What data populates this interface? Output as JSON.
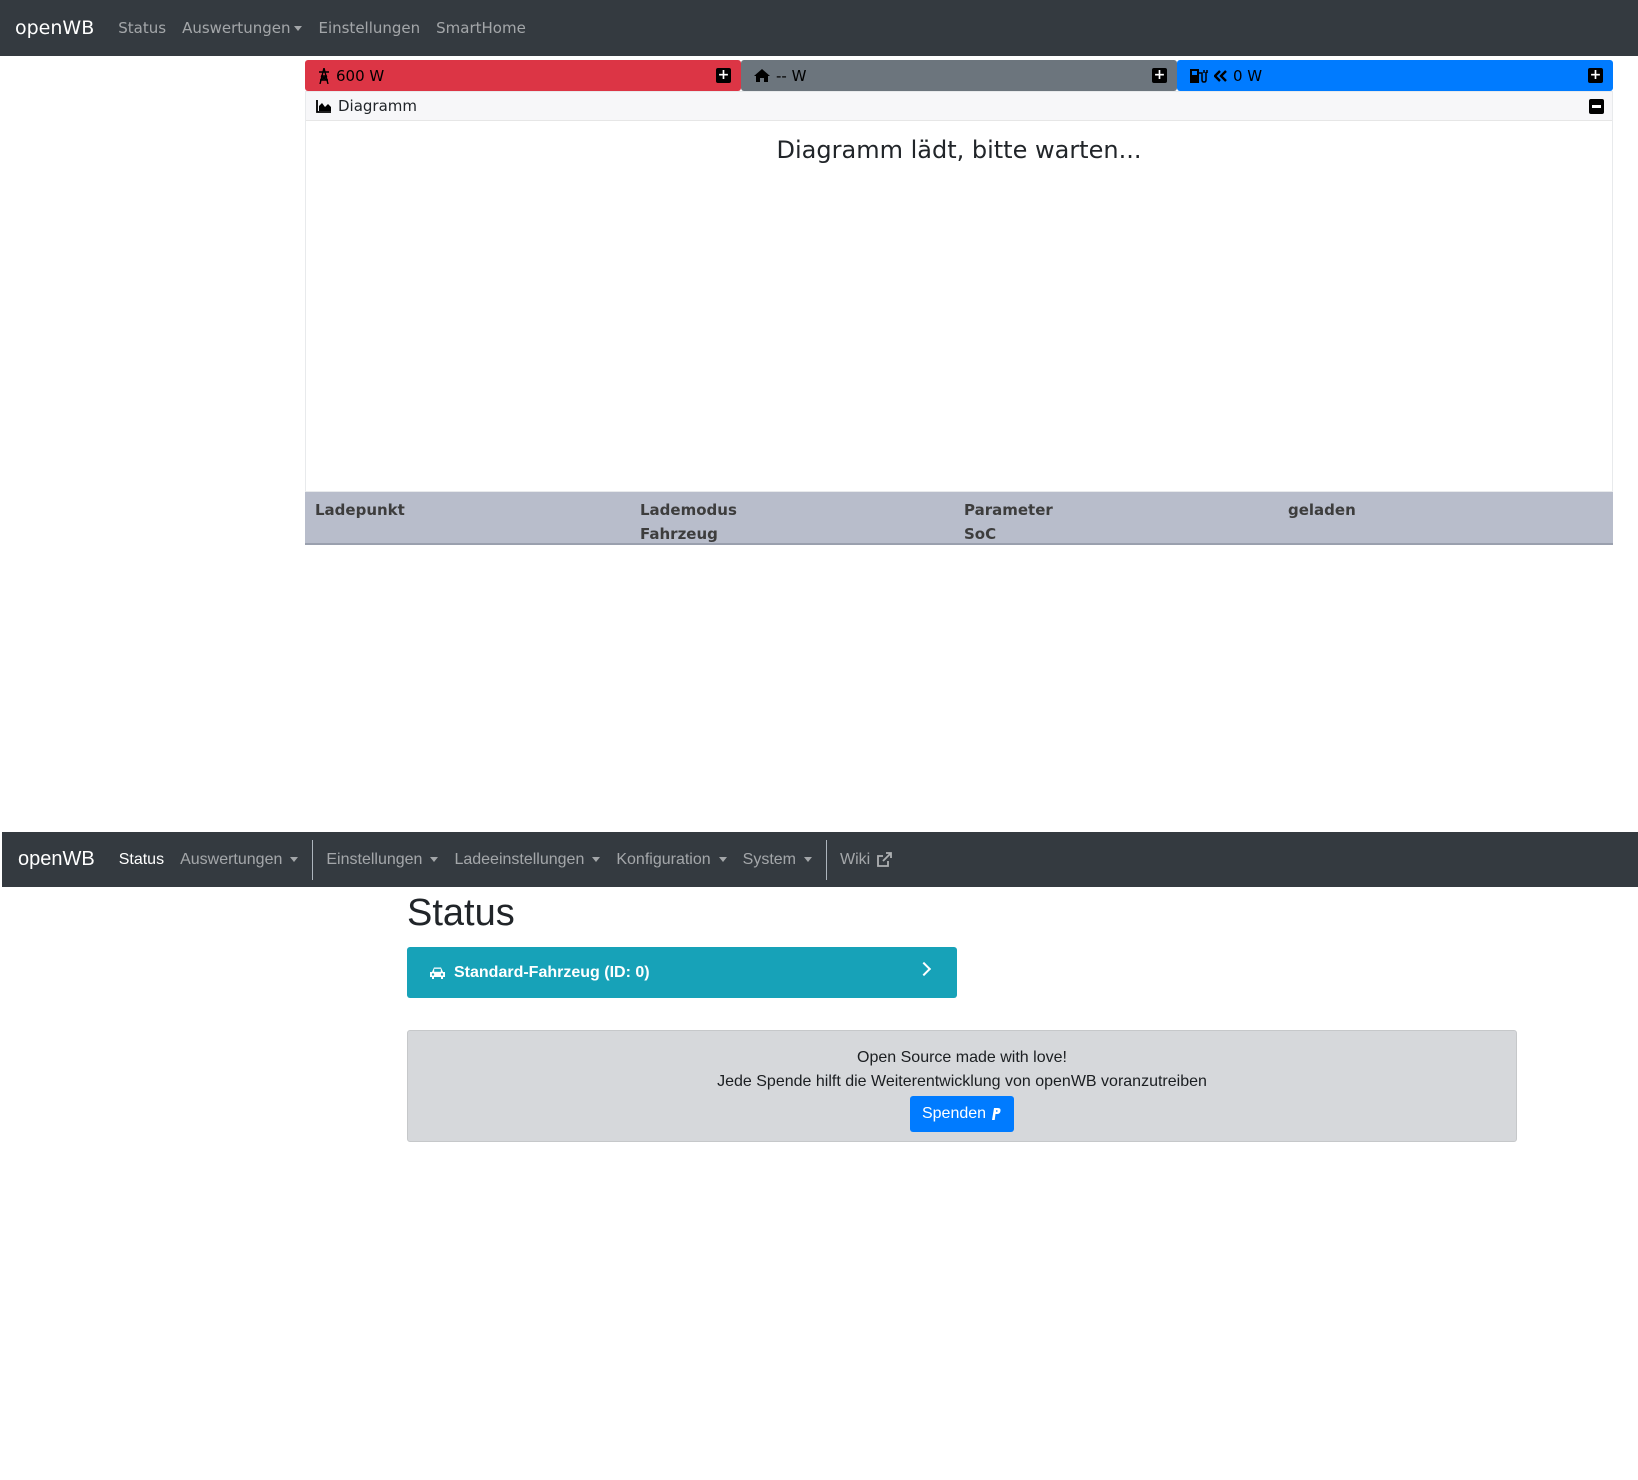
{
  "top": {
    "navbar": {
      "brand": "openWB",
      "items": [
        {
          "label": "Status"
        },
        {
          "label": "Auswertungen",
          "dropdown": true
        },
        {
          "label": "Einstellungen"
        },
        {
          "label": "SmartHome"
        }
      ]
    },
    "power_bars": {
      "grid": {
        "value": "600 W",
        "color": "#dc3545",
        "icon": "grid-tower-icon"
      },
      "house": {
        "value": "-- W",
        "color": "#6c757d",
        "icon": "house-icon"
      },
      "charge": {
        "value": "0 W",
        "color": "#007bff",
        "icon": "charging-station-icon"
      }
    },
    "diagram": {
      "header": "Diagramm",
      "loading_text": "Diagramm lädt, bitte warten..."
    },
    "chargepoint_table": {
      "columns": [
        {
          "line1": "Ladepunkt",
          "line2": ""
        },
        {
          "line1": "Lademodus",
          "line2": "Fahrzeug"
        },
        {
          "line1": "Parameter",
          "line2": "SoC"
        },
        {
          "line1": "geladen",
          "line2": ""
        }
      ]
    }
  },
  "bottom": {
    "navbar": {
      "brand": "openWB",
      "items": [
        {
          "label": "Status",
          "active": true
        },
        {
          "label": "Auswertungen",
          "dropdown": true
        },
        {
          "label": "Einstellungen",
          "dropdown": true
        },
        {
          "label": "Ladeeinstellungen",
          "dropdown": true
        },
        {
          "label": "Konfiguration",
          "dropdown": true
        },
        {
          "label": "System",
          "dropdown": true
        },
        {
          "label": "Wiki",
          "external": true
        }
      ]
    },
    "page_title": "Status",
    "vehicle": {
      "label": "Standard-Fahrzeug (ID: 0)",
      "color": "#17a2b8"
    },
    "donate": {
      "line1": "Open Source made with love!",
      "line2": "Jede Spende hilft die Weiterentwicklung von openWB voranzutreiben",
      "button": "Spenden"
    }
  }
}
